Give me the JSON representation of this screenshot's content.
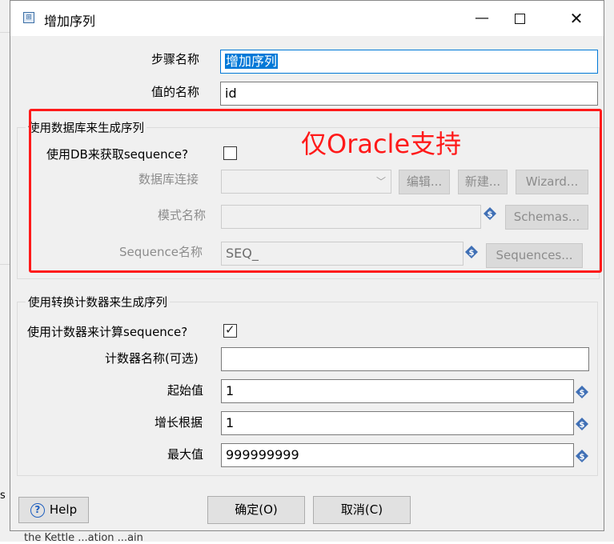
{
  "background": {
    "left_text": "s",
    "bottom_text": "the Kettle  ...ation  ...ain"
  },
  "window": {
    "title": "增加序列",
    "icon": "dialog-app-icon",
    "minimize": "—",
    "close": "✕"
  },
  "fields": {
    "step_name_label": "步骤名称",
    "step_name_value": "增加序列",
    "value_name_label": "值的名称",
    "value_name_value": "id"
  },
  "db_group": {
    "title": "使用数据库来生成序列",
    "use_db_label": "使用DB来获取sequence?",
    "use_db_checked": false,
    "connection_label": "数据库连接",
    "connection_value": "",
    "edit_button": "编辑...",
    "new_button": "新建...",
    "wizard_button": "Wizard...",
    "schema_label": "模式名称",
    "schema_value": "",
    "schemas_button": "Schemas...",
    "sequence_label": "Sequence名称",
    "sequence_value": "SEQ_",
    "sequences_button": "Sequences..."
  },
  "counter_group": {
    "title": "使用转换计数器来生成序列",
    "use_counter_label": "使用计数器来计算sequence?",
    "use_counter_checked": true,
    "counter_name_label": "计数器名称(可选)",
    "counter_name_value": "",
    "start_label": "起始值",
    "start_value": "1",
    "increment_label": "增长根据",
    "increment_value": "1",
    "max_label": "最大值",
    "max_value": "999999999"
  },
  "buttons": {
    "help": "Help",
    "ok": "确定(O)",
    "cancel": "取消(C)"
  },
  "annotation": {
    "text": "仅Oracle支持",
    "color": "#ff1a1a"
  },
  "colors": {
    "focus_border": "#0078d7",
    "variable_icon": "#3f6fb5"
  }
}
